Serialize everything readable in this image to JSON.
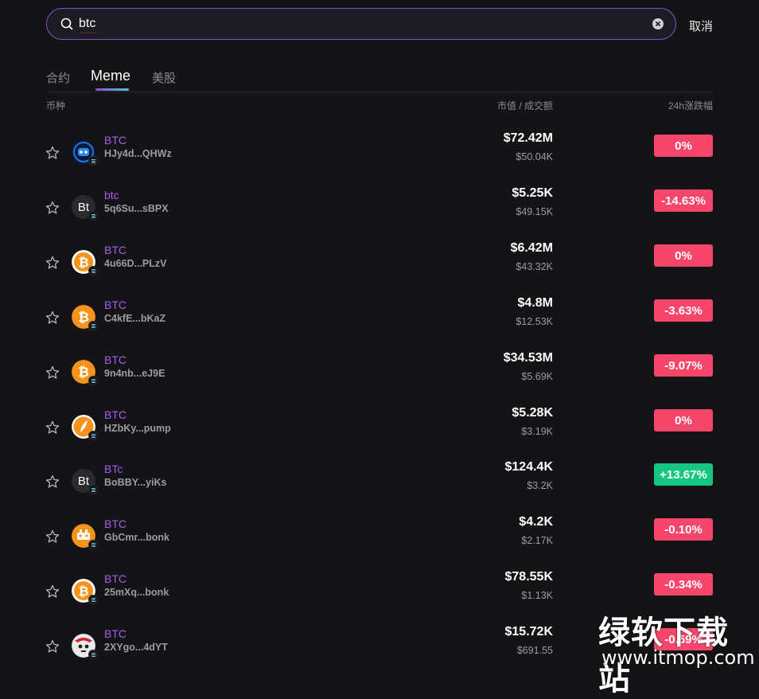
{
  "search": {
    "value": "btc",
    "cancel_label": "取消"
  },
  "tabs": [
    {
      "label": "合约"
    },
    {
      "label": "Meme"
    },
    {
      "label": "美股"
    }
  ],
  "columns": {
    "coin": "币种",
    "mcap_volume": "市值 / 成交额",
    "change": "24h涨跌幅"
  },
  "colors": {
    "accent": "#a55cf0",
    "down": "#f6466b",
    "up": "#16c784"
  },
  "rows": [
    {
      "symbol": "BTC",
      "address": "HJy4d...QHWz",
      "market_cap": "$72.42M",
      "volume": "$50.04K",
      "change": "0%",
      "direction": "down",
      "icon": "blue-robot-icon"
    },
    {
      "symbol": "btc",
      "address": "5q6Su...sBPX",
      "market_cap": "$5.25K",
      "volume": "$49.15K",
      "change": "-14.63%",
      "direction": "down",
      "icon": "bt-text-icon",
      "icon_text": "Bt"
    },
    {
      "symbol": "BTC",
      "address": "4u66D...PLzV",
      "market_cap": "$6.42M",
      "volume": "$43.32K",
      "change": "0%",
      "direction": "down",
      "icon": "bitcoin-ring-icon"
    },
    {
      "symbol": "BTC",
      "address": "C4kfE...bKaZ",
      "market_cap": "$4.8M",
      "volume": "$12.53K",
      "change": "-3.63%",
      "direction": "down",
      "icon": "bitcoin-icon"
    },
    {
      "symbol": "BTC",
      "address": "9n4nb...eJ9E",
      "market_cap": "$34.53M",
      "volume": "$5.69K",
      "change": "-9.07%",
      "direction": "down",
      "icon": "bitcoin-icon"
    },
    {
      "symbol": "BTC",
      "address": "HZbKy...pump",
      "market_cap": "$5.28K",
      "volume": "$3.19K",
      "change": "0%",
      "direction": "down",
      "icon": "bitcoin-feather-icon"
    },
    {
      "symbol": "BTc",
      "address": "BoBBY...yiKs",
      "market_cap": "$124.4K",
      "volume": "$3.2K",
      "change": "+13.67%",
      "direction": "up",
      "icon": "bt-text-icon",
      "icon_text": "Bt"
    },
    {
      "symbol": "BTC",
      "address": "GbCmr...bonk",
      "market_cap": "$4.2K",
      "volume": "$2.17K",
      "change": "-0.10%",
      "direction": "down",
      "icon": "bitcoin-dog-icon"
    },
    {
      "symbol": "BTC",
      "address": "25mXq...bonk",
      "market_cap": "$78.55K",
      "volume": "$1.13K",
      "change": "-0.34%",
      "direction": "down",
      "icon": "bitcoin-ring-icon"
    },
    {
      "symbol": "BTC",
      "address": "2XYgo...4dYT",
      "market_cap": "$15.72K",
      "volume": "$691.55",
      "change": "-0.59%",
      "direction": "down",
      "icon": "skull-avatar-icon"
    }
  ],
  "watermark": {
    "title": "绿软下载站",
    "url": "www.itmop.com"
  }
}
